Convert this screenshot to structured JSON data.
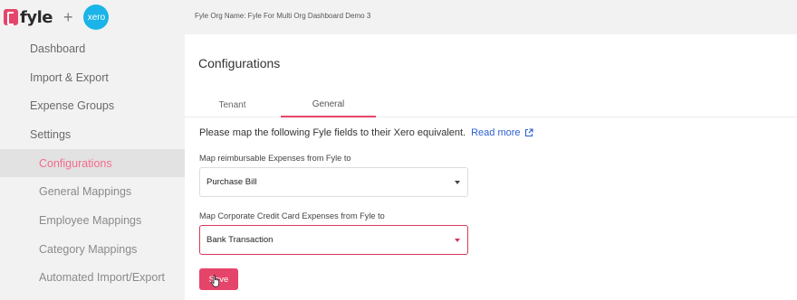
{
  "header": {
    "brand": "fyle",
    "plus": "+",
    "integration_logo": "xero",
    "org_name": "Fyle Org Name: Fyle For Multi Org Dashboard Demo 3"
  },
  "sidebar": {
    "items": [
      {
        "label": "Dashboard",
        "level": "top",
        "active": false
      },
      {
        "label": "Import & Export",
        "level": "top",
        "active": false
      },
      {
        "label": "Expense Groups",
        "level": "top",
        "active": false
      },
      {
        "label": "Settings",
        "level": "top",
        "active": false
      },
      {
        "label": "Configurations",
        "level": "sub",
        "active": true
      },
      {
        "label": "General Mappings",
        "level": "sub",
        "active": false
      },
      {
        "label": "Employee Mappings",
        "level": "sub",
        "active": false
      },
      {
        "label": "Category Mappings",
        "level": "sub",
        "active": false
      },
      {
        "label": "Automated Import/Export",
        "level": "sub",
        "active": false
      }
    ]
  },
  "main": {
    "title": "Configurations",
    "tabs": [
      {
        "label": "Tenant",
        "active": false
      },
      {
        "label": "General",
        "active": true
      }
    ],
    "instruction": "Please map the following Fyle fields to their Xero equivalent.",
    "read_more": "Read more",
    "reimbursable_label": "Map reimbursable Expenses from Fyle to",
    "reimbursable_value": "Purchase Bill",
    "ccc_label": "Map Corporate Credit Card Expenses from Fyle to",
    "ccc_value": "Bank Transaction",
    "save_label": "Save"
  },
  "colors": {
    "accent": "#e5456a",
    "active_nav_text": "#f26d8f",
    "link": "#2c5fcf",
    "xero_blue": "#1ab4e8",
    "sidebar_bg": "#f2f2f2"
  },
  "icons": [
    "fyle-logo-icon",
    "xero-logo-icon",
    "external-link-icon",
    "chevron-down-icon",
    "hand-pointer-cursor-icon"
  ]
}
